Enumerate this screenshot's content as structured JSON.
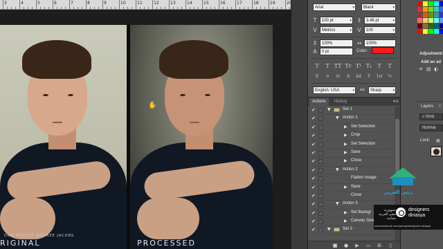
{
  "ruler": {
    "numbers": [
      "3",
      "4",
      "5",
      "6",
      "7",
      "8",
      "9",
      "10",
      "11",
      "12",
      "13",
      "14",
      "15",
      "16",
      "17",
      "18",
      "19",
      "20"
    ]
  },
  "canvas": {
    "left_caption": "RIGINAL",
    "right_caption": "PROCESSED",
    "credits": [
      "DON MERVES",
      "@RENEE JACOBS"
    ]
  },
  "character": {
    "font_family": "Arial",
    "font_style": "Black",
    "font_size": "100 pt",
    "leading": "3.46 pt",
    "kerning": "Metrics",
    "tracking": "100",
    "vertical_scale": "100%",
    "horizontal_scale": "100%",
    "baseline_shift": "0 pt",
    "color_label": "Color:",
    "color_value": "#ff1a1a",
    "type_buttons": [
      "T",
      "T",
      "TT",
      "Tr",
      "T¹",
      "T₁",
      "T",
      "T"
    ],
    "opentype_buttons": [
      "fi",
      "ơ",
      "st",
      "A",
      "ād",
      "T",
      "1st",
      "½"
    ],
    "language": "English: USA",
    "antialias_icon": "aa",
    "antialias": "Sharp"
  },
  "actions_panel": {
    "tabs": [
      "Actions",
      "History"
    ],
    "rows": [
      {
        "level": 0,
        "type": "set",
        "name": "Set 1",
        "expanded": true
      },
      {
        "level": 1,
        "type": "action",
        "name": "Action 1",
        "expanded": true
      },
      {
        "level": 2,
        "type": "step",
        "name": "Set Selection",
        "expandable": true
      },
      {
        "level": 2,
        "type": "step",
        "name": "Crop",
        "expandable": true
      },
      {
        "level": 2,
        "type": "step",
        "name": "Set Selection",
        "expandable": true
      },
      {
        "level": 2,
        "type": "step",
        "name": "Save",
        "expandable": true
      },
      {
        "level": 2,
        "type": "step",
        "name": "Close",
        "expandable": true
      },
      {
        "level": 1,
        "type": "action",
        "name": "Action 2",
        "expanded": true
      },
      {
        "level": 2,
        "type": "step",
        "name": "Flatten Image",
        "expandable": false
      },
      {
        "level": 2,
        "type": "step",
        "name": "Save",
        "expandable": true
      },
      {
        "level": 2,
        "type": "step",
        "name": "Close",
        "expandable": false
      },
      {
        "level": 1,
        "type": "action",
        "name": "Action 3",
        "expanded": true
      },
      {
        "level": 2,
        "type": "step",
        "name": "Set Backgr",
        "expandable": true
      },
      {
        "level": 2,
        "type": "step",
        "name": "Canvas Size",
        "expandable": true
      },
      {
        "level": 0,
        "type": "set",
        "name": "Set 2",
        "expanded": true
      }
    ],
    "bottom_icons": [
      "stop-icon",
      "record-icon",
      "play-icon",
      "new-set-icon",
      "new-action-icon",
      "trash-icon"
    ]
  },
  "right_column": {
    "adjustments_title": "Adjustment",
    "add_adjustment": "Add an ad",
    "layers_tabs": [
      "Layers",
      "C"
    ],
    "kind": "Kind",
    "blend_mode": "Normal",
    "lock_label": "Lock:"
  },
  "branding": {
    "arabic": [
      "جمهورية",
      "مصر العربية",
      "مجانية"
    ],
    "name": [
      "designers",
      "dinasya"
    ],
    "url": "www.facebook.com/groups/designers.dinasya",
    "house_text": "ربتي العربي"
  }
}
